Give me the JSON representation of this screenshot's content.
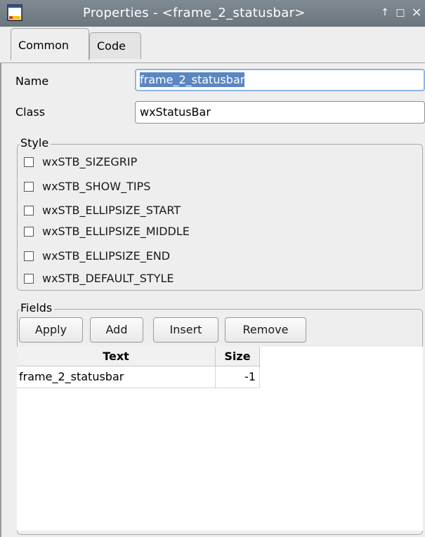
{
  "window": {
    "title": "Properties - <frame_2_statusbar>",
    "buttons": [
      {
        "icon": "up-arrow-icon",
        "glyph": "↑"
      },
      {
        "icon": "maximize-icon",
        "glyph": "□"
      },
      {
        "icon": "close-icon",
        "glyph": "×"
      }
    ]
  },
  "tabs": [
    {
      "label": "Common",
      "active": true
    },
    {
      "label": "Code",
      "active": false
    }
  ],
  "form": {
    "name_label": "Name",
    "name_value": "frame_2_statusbar",
    "class_label": "Class",
    "class_value": "wxStatusBar"
  },
  "style_group": {
    "title": "Style",
    "options": [
      {
        "label": "wxSTB_SIZEGRIP",
        "checked": false
      },
      {
        "label": "wxSTB_SHOW_TIPS",
        "checked": false
      },
      {
        "label": "wxSTB_ELLIPSIZE_START",
        "checked": false
      },
      {
        "label": "wxSTB_ELLIPSIZE_MIDDLE",
        "checked": false
      },
      {
        "label": "wxSTB_ELLIPSIZE_END",
        "checked": false
      },
      {
        "label": "wxSTB_DEFAULT_STYLE",
        "checked": false
      }
    ]
  },
  "fields_group": {
    "title": "Fields",
    "buttons": {
      "apply": "Apply",
      "add": "Add",
      "insert": "Insert",
      "remove": "Remove"
    },
    "table": {
      "columns": [
        "Text",
        "Size"
      ],
      "rows": [
        [
          "frame_2_statusbar",
          "-1"
        ]
      ]
    }
  },
  "colors": {
    "titlebar": "#737d86",
    "selection": "#5b86c2",
    "focus_border": "#8cb6e6"
  }
}
